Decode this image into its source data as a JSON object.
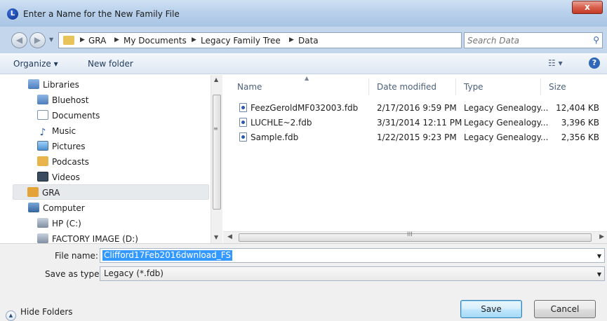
{
  "window": {
    "title": "Enter a Name for the New Family File",
    "app_icon": "legacy-icon",
    "close_label": "x"
  },
  "address": {
    "crumbs": [
      "GRA",
      "My Documents",
      "Legacy Family Tree",
      "Data"
    ],
    "search_placeholder": "Search Data"
  },
  "toolbar": {
    "organize": "Organize ▾",
    "new_folder": "New folder",
    "help": "?"
  },
  "nav": {
    "items": [
      {
        "label": "Libraries",
        "icon": "libraries-icon"
      },
      {
        "label": "Bluehost",
        "icon": "library-icon"
      },
      {
        "label": "Documents",
        "icon": "documents-icon"
      },
      {
        "label": "Music",
        "icon": "music-icon"
      },
      {
        "label": "Pictures",
        "icon": "pictures-icon"
      },
      {
        "label": "Podcasts",
        "icon": "podcasts-icon"
      },
      {
        "label": "Videos",
        "icon": "videos-icon"
      },
      {
        "label": "GRA",
        "icon": "user-folder-icon"
      },
      {
        "label": "Computer",
        "icon": "computer-icon"
      },
      {
        "label": "HP (C:)",
        "icon": "drive-icon"
      },
      {
        "label": "FACTORY IMAGE (D:)",
        "icon": "drive-icon"
      }
    ]
  },
  "files": {
    "columns": [
      "Name",
      "Date modified",
      "Type",
      "Size"
    ],
    "rows": [
      {
        "name": "FeezGeroldMF032003.fdb",
        "date": "2/17/2016 9:59 PM",
        "type": "Legacy Genealogy...",
        "size": "12,404 KB"
      },
      {
        "name": "LUCHLE~2.fdb",
        "date": "3/31/2014 12:11 PM",
        "type": "Legacy Genealogy...",
        "size": "3,396 KB"
      },
      {
        "name": "Sample.fdb",
        "date": "1/22/2015 9:23 PM",
        "type": "Legacy Genealogy...",
        "size": "2,356 KB"
      }
    ]
  },
  "form": {
    "filename_label": "File name:",
    "filename_value": "Clifford17Feb2016dwnload_FS",
    "savetype_label": "Save as type:",
    "savetype_value": "Legacy (*.fdb)"
  },
  "buttons": {
    "hide_folders": "Hide Folders",
    "save": "Save",
    "cancel": "Cancel"
  },
  "colors": {
    "accent": "#3399ff",
    "close": "#c33b25"
  }
}
